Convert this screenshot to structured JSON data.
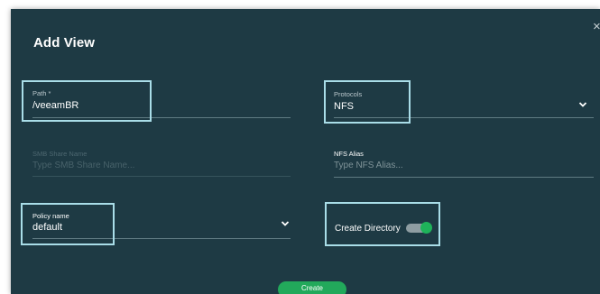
{
  "dialog": {
    "title": "Add View",
    "close_glyph": "×",
    "close_icon": "close-icon"
  },
  "path": {
    "label": "Path *",
    "value": "/veeamBR"
  },
  "protocols": {
    "label": "Protocols",
    "value": "NFS",
    "icon": "chevron-down-icon"
  },
  "smb_share": {
    "label": "SMB Share Name",
    "placeholder": "Type SMB Share Name..."
  },
  "nfs_alias": {
    "label": "NFS Alias",
    "placeholder": "Type NFS Alias..."
  },
  "policy": {
    "label": "Policy name",
    "value": "default",
    "icon": "chevron-down-icon"
  },
  "create_directory": {
    "label": "Create Directory",
    "enabled": true
  },
  "actions": {
    "create_label": "Create"
  },
  "colors": {
    "dialog_bg": "#1e3a44",
    "highlight": "#a9dde8",
    "accent_green": "#22a95b"
  }
}
